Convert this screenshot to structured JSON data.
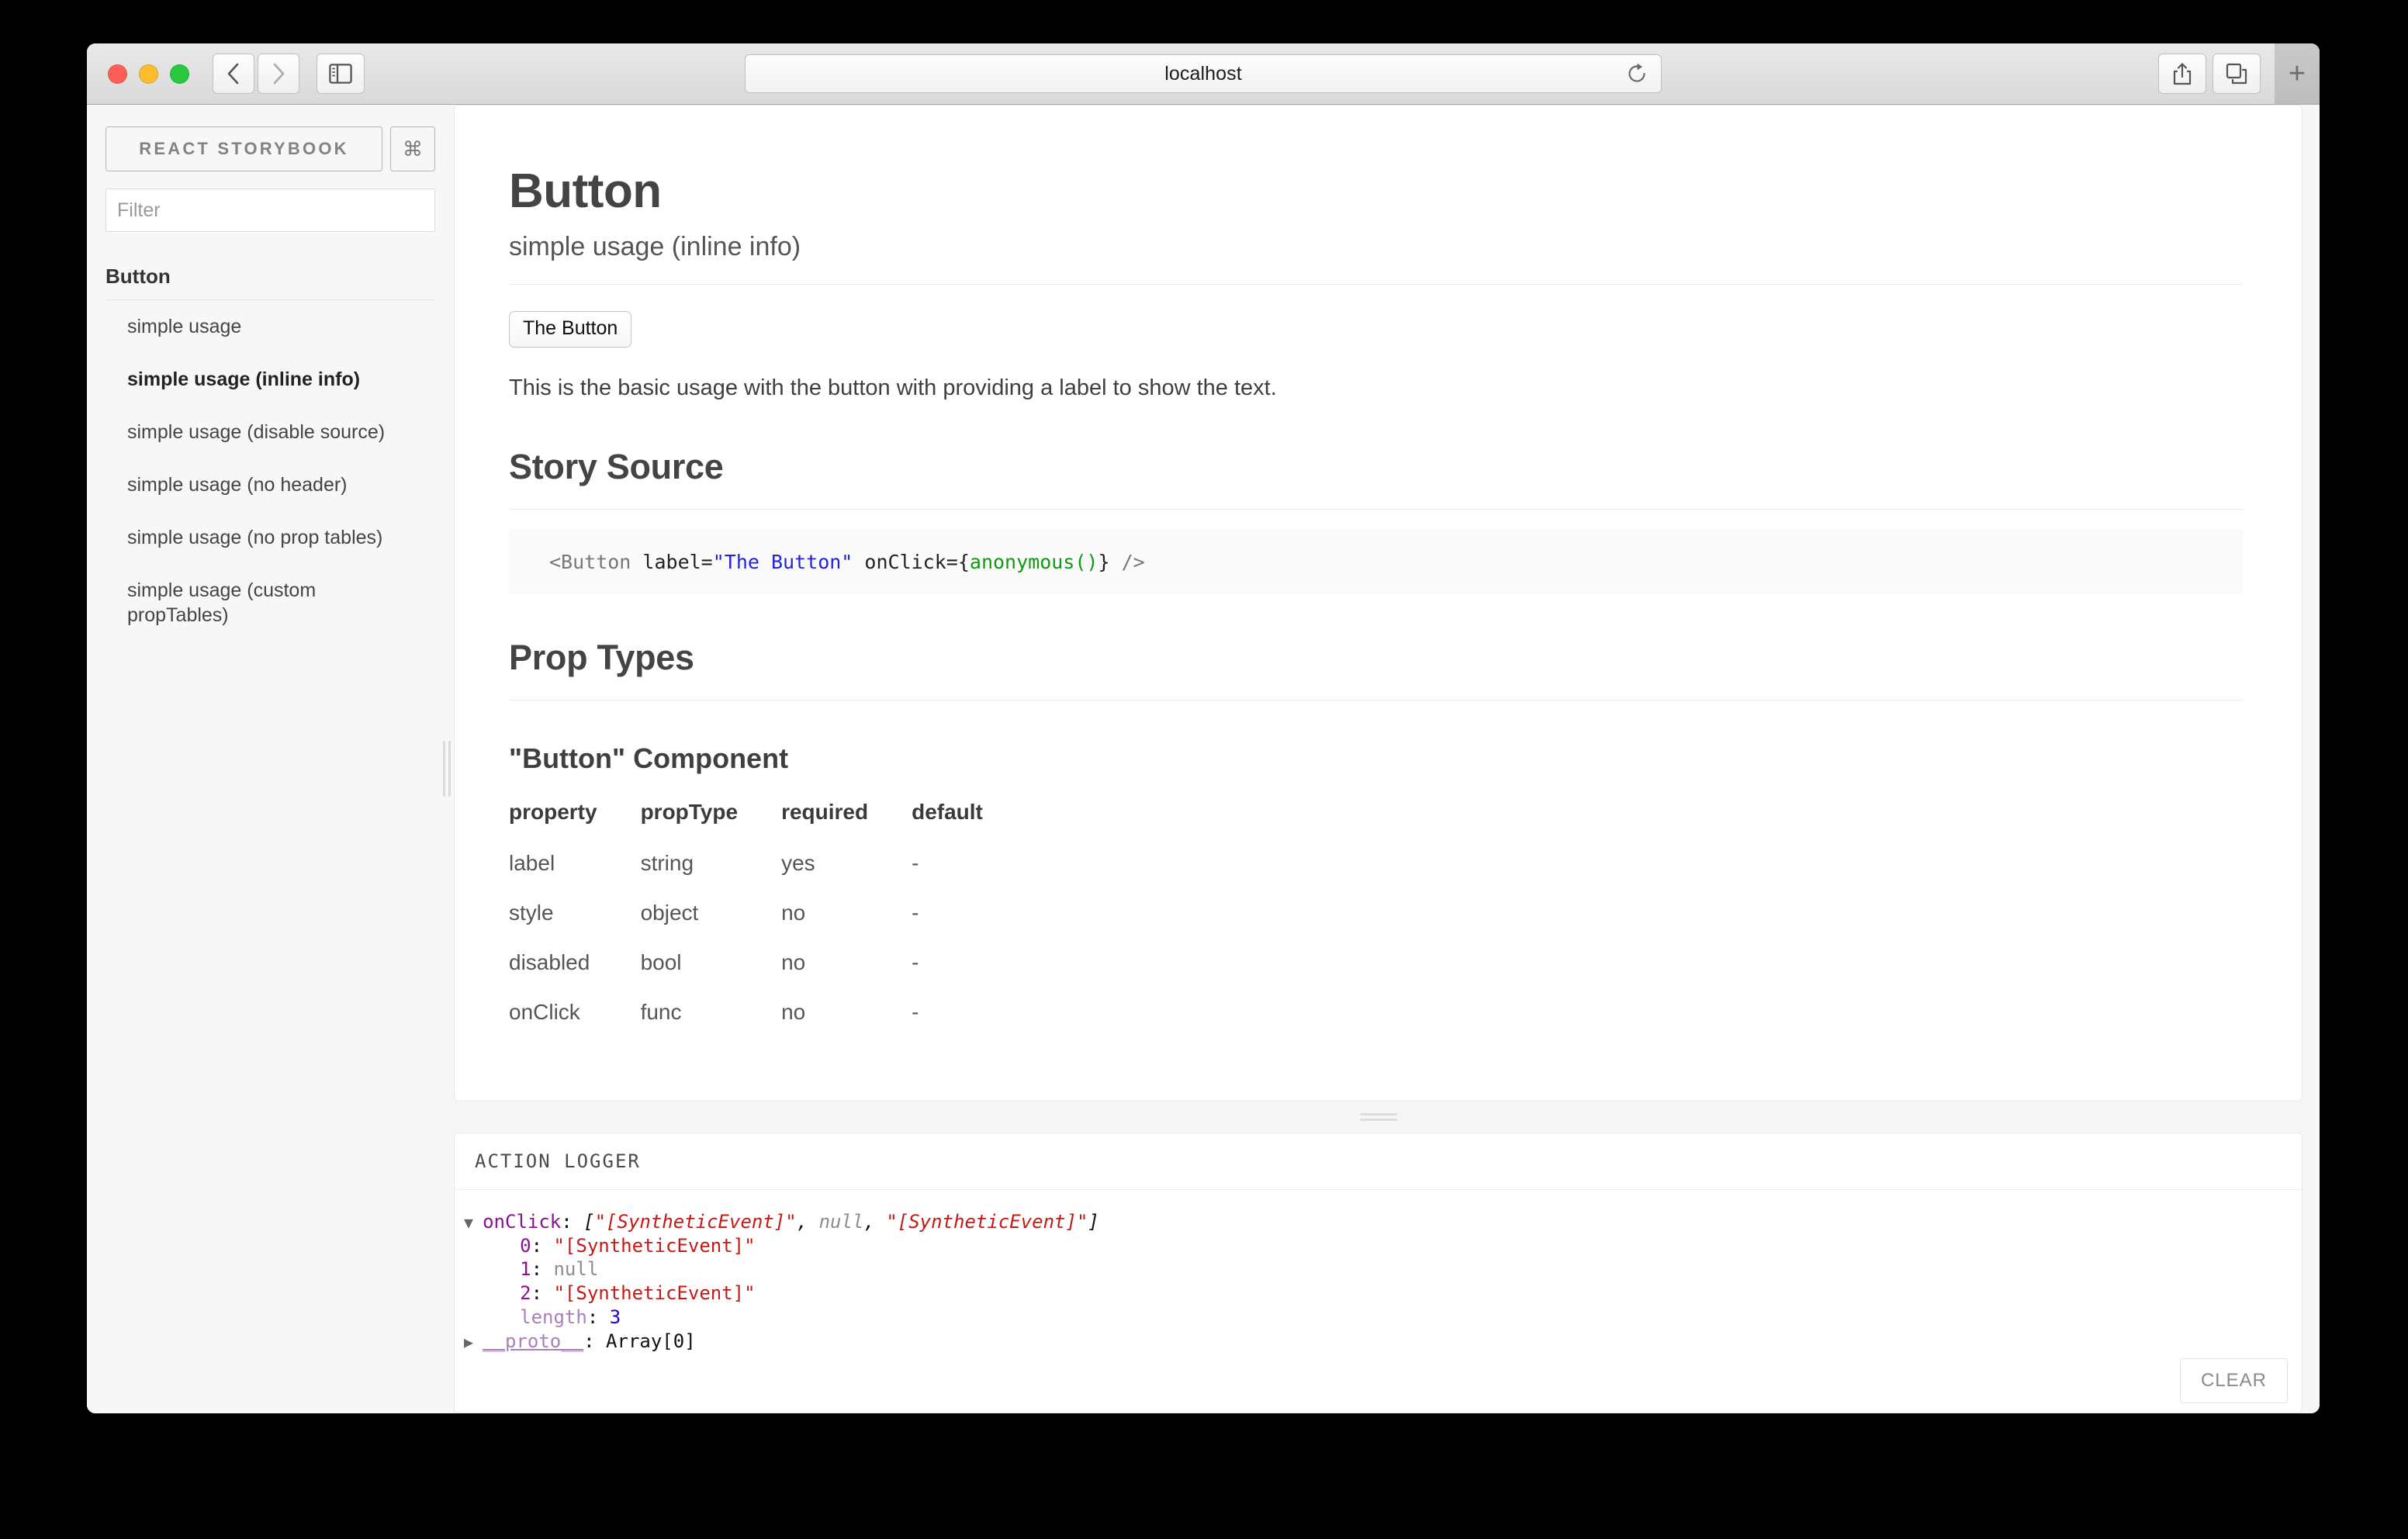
{
  "browser": {
    "url": "localhost",
    "icons": {
      "back": "back-chevron-icon",
      "forward": "forward-chevron-icon",
      "sidebar": "sidebar-toggle-icon",
      "reload": "reload-icon",
      "share": "share-icon",
      "tabs": "show-all-tabs-icon",
      "newtab": "+"
    }
  },
  "sidebar": {
    "logo": "REACT STORYBOOK",
    "shortcut_key": "⌘",
    "filter": {
      "value": "",
      "placeholder": "Filter"
    },
    "kinds": [
      {
        "name": "Button",
        "stories": [
          {
            "label": "simple usage",
            "active": false
          },
          {
            "label": "simple usage (inline info)",
            "active": true
          },
          {
            "label": "simple usage (disable source)",
            "active": false
          },
          {
            "label": "simple usage (no header)",
            "active": false
          },
          {
            "label": "simple usage (no prop tables)",
            "active": false
          },
          {
            "label": "simple usage (custom propTables)",
            "active": false
          }
        ]
      }
    ]
  },
  "preview": {
    "title": "Button",
    "subtitle": "simple usage (inline info)",
    "demo_button_label": "The Button",
    "description": "This is the basic usage with the button with providing a label to show the text.",
    "story_source": {
      "heading": "Story Source",
      "tokens": [
        {
          "text": "<Button ",
          "type": "tag"
        },
        {
          "text": "label=",
          "type": "attr"
        },
        {
          "text": "\"The Button\"",
          "type": "string"
        },
        {
          "text": " onClick=",
          "type": "attr"
        },
        {
          "text": "{",
          "type": "brace"
        },
        {
          "text": "anonymous()",
          "type": "fn"
        },
        {
          "text": "}",
          "type": "brace"
        },
        {
          "text": " />",
          "type": "tag"
        }
      ]
    },
    "prop_types": {
      "heading": "Prop Types",
      "component_heading": "\"Button\" Component",
      "columns": [
        "property",
        "propType",
        "required",
        "default"
      ],
      "rows": [
        [
          "label",
          "string",
          "yes",
          "-"
        ],
        [
          "style",
          "object",
          "no",
          "-"
        ],
        [
          "disabled",
          "bool",
          "no",
          "-"
        ],
        [
          "onClick",
          "func",
          "no",
          "-"
        ]
      ]
    }
  },
  "logger": {
    "title": "ACTION LOGGER",
    "clear_label": "CLEAR",
    "lines": [
      {
        "indent": 0,
        "marker": "▼",
        "parts": [
          {
            "text": "onClick",
            "cls": "k-name"
          },
          {
            "text": ": ",
            "cls": "punct"
          },
          {
            "text": "[",
            "cls": "punct-i"
          },
          {
            "text": "\"[SyntheticEvent]\"",
            "cls": "v-stri"
          },
          {
            "text": ", ",
            "cls": "punct-i"
          },
          {
            "text": "null",
            "cls": "v-null"
          },
          {
            "text": ", ",
            "cls": "punct-i"
          },
          {
            "text": "\"[SyntheticEvent]\"",
            "cls": "v-stri"
          },
          {
            "text": "]",
            "cls": "punct-i"
          }
        ]
      },
      {
        "indent": 1,
        "marker": "",
        "parts": [
          {
            "text": "0",
            "cls": "k-idx"
          },
          {
            "text": ": ",
            "cls": "punct"
          },
          {
            "text": "\"[SyntheticEvent]\"",
            "cls": "v-str"
          }
        ]
      },
      {
        "indent": 1,
        "marker": "",
        "parts": [
          {
            "text": "1",
            "cls": "k-idx"
          },
          {
            "text": ": ",
            "cls": "punct"
          },
          {
            "text": "null",
            "cls": "v-nullp"
          }
        ]
      },
      {
        "indent": 1,
        "marker": "",
        "parts": [
          {
            "text": "2",
            "cls": "k-idx"
          },
          {
            "text": ": ",
            "cls": "punct"
          },
          {
            "text": "\"[SyntheticEvent]\"",
            "cls": "v-str"
          }
        ]
      },
      {
        "indent": 1,
        "marker": "",
        "parts": [
          {
            "text": "length",
            "cls": "k-dim"
          },
          {
            "text": ": ",
            "cls": "punct"
          },
          {
            "text": "3",
            "cls": "v-num"
          }
        ]
      },
      {
        "indent": 0,
        "marker": "▶",
        "parts": [
          {
            "text": "__proto__",
            "cls": "k-dim underl"
          },
          {
            "text": ": ",
            "cls": "punct"
          },
          {
            "text": "Array[0]",
            "cls": "v-plain"
          }
        ]
      }
    ]
  }
}
